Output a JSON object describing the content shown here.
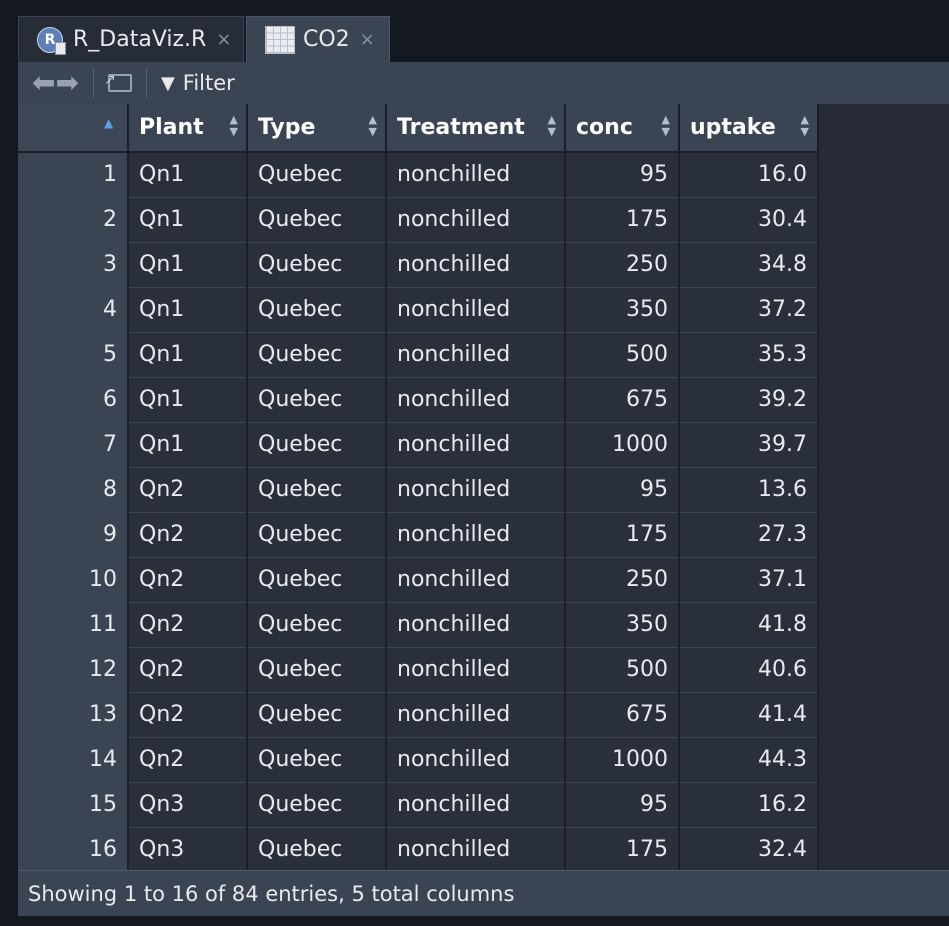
{
  "tabs": [
    {
      "label": "R_DataViz.R",
      "icon": "r-file-icon",
      "close": "×"
    },
    {
      "label": "CO2",
      "icon": "grid-icon",
      "close": "×"
    }
  ],
  "toolbar": {
    "back": "⬅",
    "forward": "➡",
    "filter_label": "Filter",
    "filter_icon": "▼"
  },
  "table": {
    "columns": [
      "Plant",
      "Type",
      "Treatment",
      "conc",
      "uptake"
    ],
    "rows": [
      [
        "1",
        "Qn1",
        "Quebec",
        "nonchilled",
        "95",
        "16.0"
      ],
      [
        "2",
        "Qn1",
        "Quebec",
        "nonchilled",
        "175",
        "30.4"
      ],
      [
        "3",
        "Qn1",
        "Quebec",
        "nonchilled",
        "250",
        "34.8"
      ],
      [
        "4",
        "Qn1",
        "Quebec",
        "nonchilled",
        "350",
        "37.2"
      ],
      [
        "5",
        "Qn1",
        "Quebec",
        "nonchilled",
        "500",
        "35.3"
      ],
      [
        "6",
        "Qn1",
        "Quebec",
        "nonchilled",
        "675",
        "39.2"
      ],
      [
        "7",
        "Qn1",
        "Quebec",
        "nonchilled",
        "1000",
        "39.7"
      ],
      [
        "8",
        "Qn2",
        "Quebec",
        "nonchilled",
        "95",
        "13.6"
      ],
      [
        "9",
        "Qn2",
        "Quebec",
        "nonchilled",
        "175",
        "27.3"
      ],
      [
        "10",
        "Qn2",
        "Quebec",
        "nonchilled",
        "250",
        "37.1"
      ],
      [
        "11",
        "Qn2",
        "Quebec",
        "nonchilled",
        "350",
        "41.8"
      ],
      [
        "12",
        "Qn2",
        "Quebec",
        "nonchilled",
        "500",
        "40.6"
      ],
      [
        "13",
        "Qn2",
        "Quebec",
        "nonchilled",
        "675",
        "41.4"
      ],
      [
        "14",
        "Qn2",
        "Quebec",
        "nonchilled",
        "1000",
        "44.3"
      ],
      [
        "15",
        "Qn3",
        "Quebec",
        "nonchilled",
        "95",
        "16.2"
      ],
      [
        "16",
        "Qn3",
        "Quebec",
        "nonchilled",
        "175",
        "32.4"
      ]
    ]
  },
  "status": "Showing 1 to 16 of 84 entries, 5 total columns",
  "colors": {
    "accent": "#5aa0e6",
    "header": "#3b4453",
    "cell": "#2a2f3c"
  }
}
